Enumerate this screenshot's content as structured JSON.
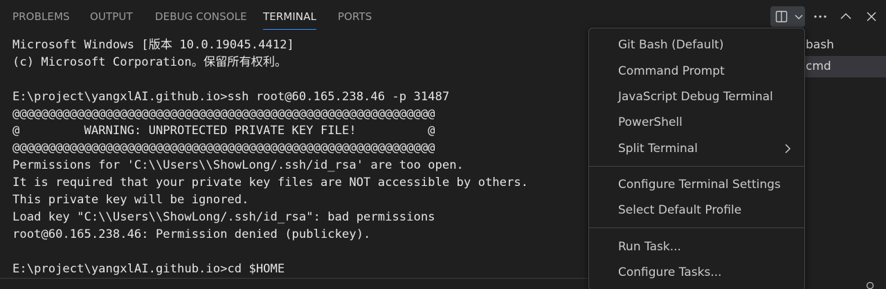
{
  "panel": {
    "tabs": [
      {
        "label": "PROBLEMS"
      },
      {
        "label": "OUTPUT"
      },
      {
        "label": "DEBUG CONSOLE"
      },
      {
        "label": "TERMINAL"
      },
      {
        "label": "PORTS"
      }
    ],
    "active_tab": "TERMINAL",
    "accent_color": "#3794ff",
    "toolbar_icons": [
      "split-terminal-icon",
      "chevron-down-icon",
      "more-actions-icon",
      "maximize-panel-icon",
      "close-panel-icon"
    ]
  },
  "terminal": {
    "lines": [
      "Microsoft Windows [版本 10.0.19045.4412]",
      "(c) Microsoft Corporation。保留所有权利。",
      "",
      "E:\\project\\yangxlAI.github.io>ssh root@60.165.238.46 -p 31487",
      "@@@@@@@@@@@@@@@@@@@@@@@@@@@@@@@@@@@@@@@@@@@@@@@@@@@@@@@@@@@",
      "@         WARNING: UNPROTECTED PRIVATE KEY FILE!          @",
      "@@@@@@@@@@@@@@@@@@@@@@@@@@@@@@@@@@@@@@@@@@@@@@@@@@@@@@@@@@@",
      "Permissions for 'C:\\\\Users\\\\ShowLong/.ssh/id_rsa' are too open.",
      "It is required that your private key files are NOT accessible by others.",
      "This private key will be ignored.",
      "Load key \"C:\\\\Users\\\\ShowLong/.ssh/id_rsa\": bad permissions",
      "root@60.165.238.46: Permission denied (publickey).",
      "",
      "E:\\project\\yangxlAI.github.io>cd $HOME"
    ]
  },
  "terminal_list": [
    {
      "label": "bash"
    },
    {
      "label": "cmd",
      "selected": true
    }
  ],
  "menu": {
    "items": [
      {
        "label": "Git Bash (Default)"
      },
      {
        "label": "Command Prompt"
      },
      {
        "label": "JavaScript Debug Terminal"
      },
      {
        "label": "PowerShell"
      },
      {
        "label": "Split Terminal",
        "has_submenu": true
      },
      {
        "label": "Configure Terminal Settings"
      },
      {
        "label": "Select Default Profile"
      },
      {
        "label": "Run Task..."
      },
      {
        "label": "Configure Tasks..."
      }
    ]
  }
}
